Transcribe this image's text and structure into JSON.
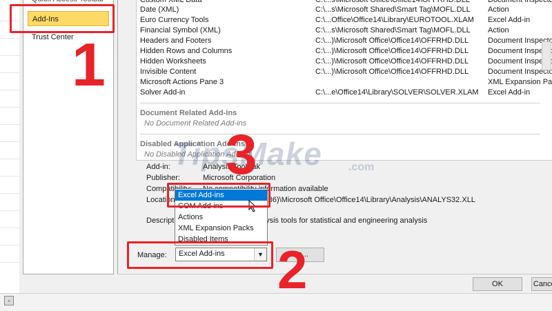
{
  "nav": {
    "partial_item": "Quick Access Toolbar",
    "items": [
      {
        "label": "Add-Ins"
      },
      {
        "label": "Trust Center"
      }
    ]
  },
  "addins": {
    "partial_row": {
      "name": "Custom XML Data",
      "location": "C:\\...s\\Microsoft Office\\Office14\\OFFRHD.DLL",
      "type": "Document Inspector"
    },
    "rows": [
      {
        "name": "Date (XML)",
        "location": "C:\\...s\\Microsoft Shared\\Smart Tag\\MOFL.DLL",
        "type": "Action"
      },
      {
        "name": "Euro Currency Tools",
        "location": "C:\\...Office\\Office14\\Library\\EUROTOOL.XLAM",
        "type": "Excel Add-in"
      },
      {
        "name": "Financial Symbol (XML)",
        "location": "C:\\...s\\Microsoft Shared\\Smart Tag\\MOFL.DLL",
        "type": "Action"
      },
      {
        "name": "Headers and Footers",
        "location": "C:\\...)\\Microsoft Office\\Office14\\OFFRHD.DLL",
        "type": "Document Inspector"
      },
      {
        "name": "Hidden Rows and Columns",
        "location": "C:\\...)\\Microsoft Office\\Office14\\OFFRHD.DLL",
        "type": "Document Inspector"
      },
      {
        "name": "Hidden Worksheets",
        "location": "C:\\...)\\Microsoft Office\\Office14\\OFFRHD.DLL",
        "type": "Document Inspector"
      },
      {
        "name": "Invisible Content",
        "location": "C:\\...)\\Microsoft Office\\Office14\\OFFRHD.DLL",
        "type": "Document Inspector"
      },
      {
        "name": "Microsoft Actions Pane 3",
        "location": "",
        "type": "XML Expansion Pack"
      },
      {
        "name": "Solver Add-in",
        "location": "C:\\...e\\Office14\\Library\\SOLVER\\SOLVER.XLAM",
        "type": "Excel Add-in"
      }
    ],
    "doc_related_heading": "Document Related Add-ins",
    "doc_related_empty": "No Document Related Add-ins",
    "disabled_heading": "Disabled Application Add-ins",
    "disabled_empty": "No Disabled Application Add-ins"
  },
  "details": {
    "addin_label": "Add-in:",
    "addin_value": "Analysis ToolPak",
    "publisher_label": "Publisher:",
    "publisher_value": "Microsoft Corporation",
    "compat_label": "Compatibility:",
    "compat_value": "No compatibility information available",
    "location_label": "Location:",
    "location_value": "C:\\Program Files (x86)\\Microsoft Office\\Office14\\Library\\Analysis\\ANALYS32.XLL",
    "description_label": "Description:",
    "description_value": "Provides data analysis tools for statistical and engineering analysis"
  },
  "manage": {
    "label": "Manage:",
    "selected": "Excel Add-ins",
    "options": [
      "Excel Add-ins",
      "COM Add-ins",
      "Actions",
      "XML Expansion Packs",
      "Disabled Items"
    ],
    "go_label": "Go..."
  },
  "footer": {
    "ok_label": "OK",
    "cancel_label": "Cancel"
  },
  "annotations": {
    "step1": "1",
    "step2": "2",
    "step3": "3",
    "color": "#e8232a"
  },
  "watermark": {
    "text": "TipsMake",
    "suffix": ".com"
  },
  "colors": {
    "nav_selected": "#ffd966",
    "dropdown_highlight": "#0078d7",
    "dialog_bg": "#f0f0f0"
  }
}
